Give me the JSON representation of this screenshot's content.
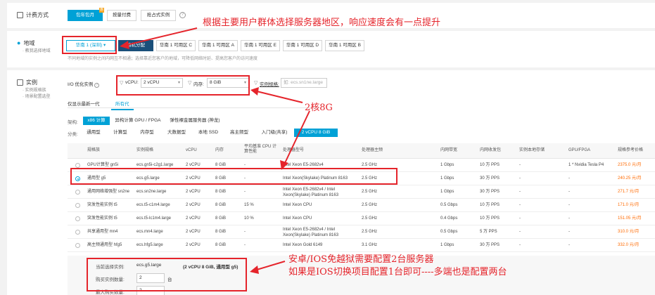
{
  "billing": {
    "title": "计费方式",
    "options": [
      "包年包月",
      "按量付费",
      "抢占式实例"
    ],
    "badge": "惠"
  },
  "region": {
    "title": "地域",
    "subtitle": "· 教我选择地域",
    "zones": [
      "华南 1 (深圳)",
      "随机分配",
      "华南 1 可用区 C",
      "华南 1 可用区 A",
      "华南 1 可用区 E",
      "华南 1 可用区 D",
      "华南 1 可用区 B"
    ],
    "hint": "不同地域的实例之间内网互不相通；选择靠近您客户的地域，可降低网络时延、提高您客户的访问速度"
  },
  "instance": {
    "title": "实例",
    "subtitle1": "· 实例规格族",
    "subtitle2": "· 场景配置选型",
    "io_label": "I/O 优化实例",
    "vcpu_label": "vCPU:",
    "vcpu_value": "2 vCPU",
    "mem_label": "内存:",
    "mem_value": "8 GiB",
    "spec_label": "实例规格:",
    "spec_placeholder": "如: ecs.sn1ne.large",
    "gen_tabs": [
      "仅显示最新一代",
      "所有代"
    ],
    "arch_label": "架构:",
    "arch_options": [
      "x86 计算",
      "异构计算 GPU / FPGA",
      "弹性裸金属服务器 (神龙)"
    ],
    "cat_label": "分类:",
    "cat_options": [
      "通用型",
      "计算型",
      "内存型",
      "大数据型",
      "本地 SSD",
      "高主频型",
      "入门级(共享)",
      "2 vCPU 8 GiB"
    ]
  },
  "table": {
    "headers": [
      "规格族",
      "实例规格",
      "vCPU",
      "内存",
      "平均基准 CPU 计算性能",
      "处理器型号",
      "处理器主频",
      "内网带宽",
      "内网收发包",
      "实例本地存储",
      "GPU/FPGA",
      "规格参考价格"
    ],
    "rows": [
      [
        "GPU计算型 gn5i",
        "ecs.gn5i-c2g1.large",
        "2 vCPU",
        "8 GiB",
        "-",
        "Intel Xeon E5-2682v4",
        "2.5 GHz",
        "1 Gbps",
        "10 万 PPS",
        "-",
        "1 * Nvidia Tesla P4",
        "2375.0 元/月"
      ],
      [
        "通用型 g5",
        "ecs.g5.large",
        "2 vCPU",
        "8 GiB",
        "-",
        "Intel Xeon(Skylake) Platinum 8163",
        "2.5 GHz",
        "1 Gbps",
        "30 万 PPS",
        "-",
        "-",
        "240.25 元/月"
      ],
      [
        "通用网络增强型 sn2ne",
        "ecs.sn2ne.large",
        "2 vCPU",
        "8 GiB",
        "-",
        "Intel Xeon E5-2682v4 / Intel Xeon(Skylake) Platinum 8163",
        "2.5 GHz",
        "1 Gbps",
        "30 万 PPS",
        "-",
        "-",
        "271.7 元/月"
      ],
      [
        "突发性能实例 t5",
        "ecs.t5-c1m4.large",
        "2 vCPU",
        "8 GiB",
        "15 %",
        "Intel Xeon CPU",
        "2.5 GHz",
        "0.5 Gbps",
        "10 万 PPS",
        "-",
        "-",
        "171.0 元/月"
      ],
      [
        "突发性能实例 t5",
        "ecs.t5-lc1m4.large",
        "2 vCPU",
        "8 GiB",
        "10 %",
        "Intel Xeon CPU",
        "2.5 GHz",
        "0.4 Gbps",
        "10 万 PPS",
        "-",
        "-",
        "151.05 元/月"
      ],
      [
        "共享通用型 mn4",
        "ecs.mn4.large",
        "2 vCPU",
        "8 GiB",
        "-",
        "Intel Xeon E5-2682v4 / Intel Xeon(Skylake) Platinum 8163",
        "2.5 GHz",
        "0.5 Gbps",
        "5 万 PPS",
        "-",
        "-",
        "310.0 元/月"
      ],
      [
        "高主频通用型 hfg5",
        "ecs.hfg5.large",
        "2 vCPU",
        "8 GiB",
        "-",
        "Intel Xeon Gold 6149",
        "3.1 GHz",
        "1 Gbps",
        "30 万 PPS",
        "-",
        "-",
        "332.0 元/月"
      ]
    ],
    "selected_row": 1
  },
  "summary": {
    "current_label": "当前选择实例:",
    "current_value": "ecs.g5.large",
    "current_desc": "(2 vCPU 8 GiB, 通用型 g5)",
    "qty_label": "购买实例数量:",
    "qty_value": "2",
    "qty_unit": "台",
    "extra_label": "最大购买数量:",
    "extra_value": "2"
  },
  "annotations": {
    "region_note": "根据主要用户群体选择服务器地区，响应速度会有一点提升",
    "cpu_note": "2核8G",
    "qty_note_1": "安卓/IOS免越狱需要配置2台服务器",
    "qty_note_2": "如果是IOS切换项目配置1台即可----多端也是配置两台"
  },
  "colors": {
    "accent": "#00a1d6",
    "annotation": "#e5242b",
    "price": "#ff6a00"
  }
}
